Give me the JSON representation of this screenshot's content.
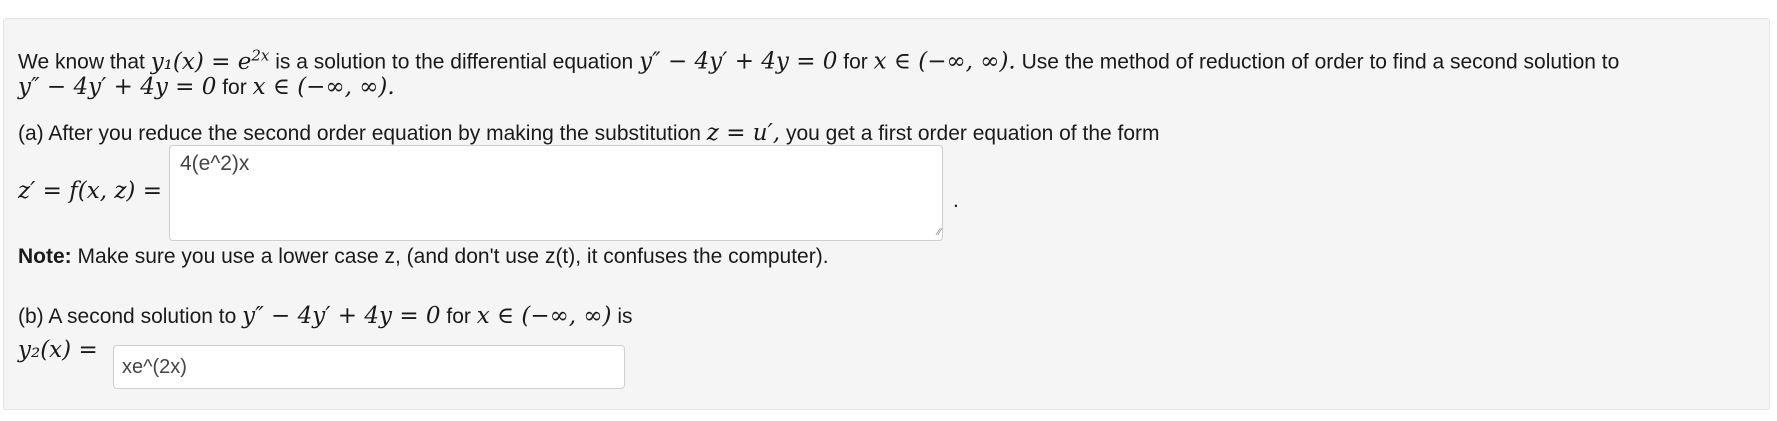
{
  "intro": {
    "t1": "We know that",
    "y1": "y₁(x) = e",
    "y1_exp": "2x",
    "t2": "is a solution to the differential equation",
    "ode": "y″ − 4y′ + 4y = 0",
    "t3": "for",
    "domain": "x ∈ (−∞, ∞).",
    "t4": "Use the method of reduction of order to find a second solution to",
    "ode2": "y″ − 4y′ + 4y = 0",
    "t5": "for",
    "domain2": "x ∈ (−∞, ∞)."
  },
  "part_a": {
    "t1": "(a) After you reduce the second order equation by making the substitution",
    "subst": "z = u′,",
    "t2": "you get a first order equation of the form",
    "lhs": "z′ = f(x, z) =",
    "answer_value": "4(e^2)x",
    "trailing_period": "."
  },
  "note": {
    "label": "Note:",
    "text": "Make sure you use a lower case z, (and don't use z(t), it confuses the computer)."
  },
  "part_b": {
    "t1": "(b) A second solution to",
    "ode": "y″ − 4y′ + 4y = 0",
    "t2": "for",
    "domain": "x ∈ (−∞, ∞)",
    "t3": "is",
    "lhs": "y₂(x) =",
    "answer_value": "xe^(2x)"
  }
}
